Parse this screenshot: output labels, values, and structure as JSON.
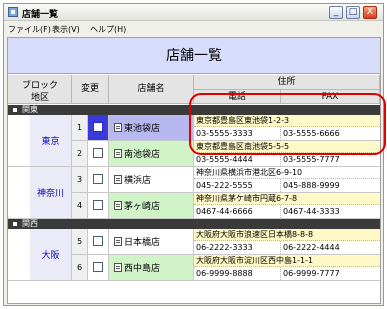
{
  "window": {
    "title": "店舗一覧",
    "minimize": "_",
    "maximize": "□",
    "close": "X"
  },
  "menu": [
    "ファイル(F)",
    "表示(V)",
    "ヘルプ(H)"
  ],
  "header": {
    "title": "店舗一覧"
  },
  "columns": {
    "block_line1": "ブロック",
    "block_line2": "地区",
    "change": "変更",
    "store": "店舗名",
    "address": "住所",
    "phone": "電話",
    "fax": "FAX"
  },
  "sections": [
    {
      "name": "関東",
      "blocks": [
        {
          "name": "東京",
          "rows": [
            {
              "no": "1",
              "store": "東池袋店",
              "address": "東京都豊島区東池袋1-2-3",
              "phone": "03-5555-3333",
              "fax": "03-5555-6666"
            },
            {
              "no": "2",
              "store": "南池袋店",
              "address": "東京都豊島区南池袋5-5-5",
              "phone": "03-5555-4444",
              "fax": "03-5555-7777"
            }
          ]
        },
        {
          "name": "神奈川",
          "rows": [
            {
              "no": "3",
              "store": "横浜店",
              "address": "神奈川県横浜市港北区6-9-10",
              "phone": "045-222-5555",
              "fax": "045-888-9999"
            },
            {
              "no": "4",
              "store": "茅ヶ崎店",
              "address": "神奈川県茅ケ崎市円蔵6-7-8",
              "phone": "0467-44-6666",
              "fax": "0467-44-3333"
            }
          ]
        }
      ]
    },
    {
      "name": "関西",
      "blocks": [
        {
          "name": "大阪",
          "rows": [
            {
              "no": "5",
              "store": "日本橋店",
              "address": "大阪府大阪市浪速区日本橋8-8-8",
              "phone": "06-2222-3333",
              "fax": "06-2222-4444"
            },
            {
              "no": "6",
              "store": "西中島店",
              "address": "大阪府大阪市淀川区西中島1-1-1",
              "phone": "06-9999-8888",
              "fax": "06-9999-7777"
            }
          ]
        }
      ]
    }
  ],
  "colors": {
    "highlight": "#e00000",
    "header_bg": "#d6dcfa",
    "section_bg": "#3a3a3a",
    "block_text": "#0000c0"
  }
}
